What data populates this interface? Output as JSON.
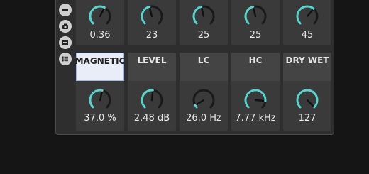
{
  "colors": {
    "accent": "#54d6cf",
    "track": "#1a1a1a",
    "panel_bg": "#2e2e2e",
    "cell_bg": "#3a3a3a",
    "header_bg": "#444444",
    "active_header_bg": "#e9edf7"
  },
  "rail": {
    "buttons": [
      {
        "icon": "collapse-icon"
      },
      {
        "icon": "snapshot-icon"
      },
      {
        "icon": "panel-icon"
      },
      {
        "icon": "list-icon"
      }
    ]
  },
  "top_row": [
    {
      "value": "0.36",
      "level": 0.6
    },
    {
      "value": "23",
      "level": 0.45
    },
    {
      "value": "25",
      "level": 0.45
    },
    {
      "value": "25",
      "level": 0.45
    },
    {
      "value": "45",
      "level": 0.65
    }
  ],
  "bottom_row": [
    {
      "label": "MAGNETIC",
      "value": "37.0 %",
      "level": 0.55,
      "active": true
    },
    {
      "label": "LEVEL",
      "value": "2.48 dB",
      "level": 0.52,
      "active": false
    },
    {
      "label": "LC",
      "value": "26.0 Hz",
      "level": 0.05,
      "active": false
    },
    {
      "label": "HC",
      "value": "7.77 kHz",
      "level": 0.85,
      "active": false
    },
    {
      "label": "DRY WET",
      "value": "127",
      "level": 1.0,
      "active": false
    }
  ]
}
